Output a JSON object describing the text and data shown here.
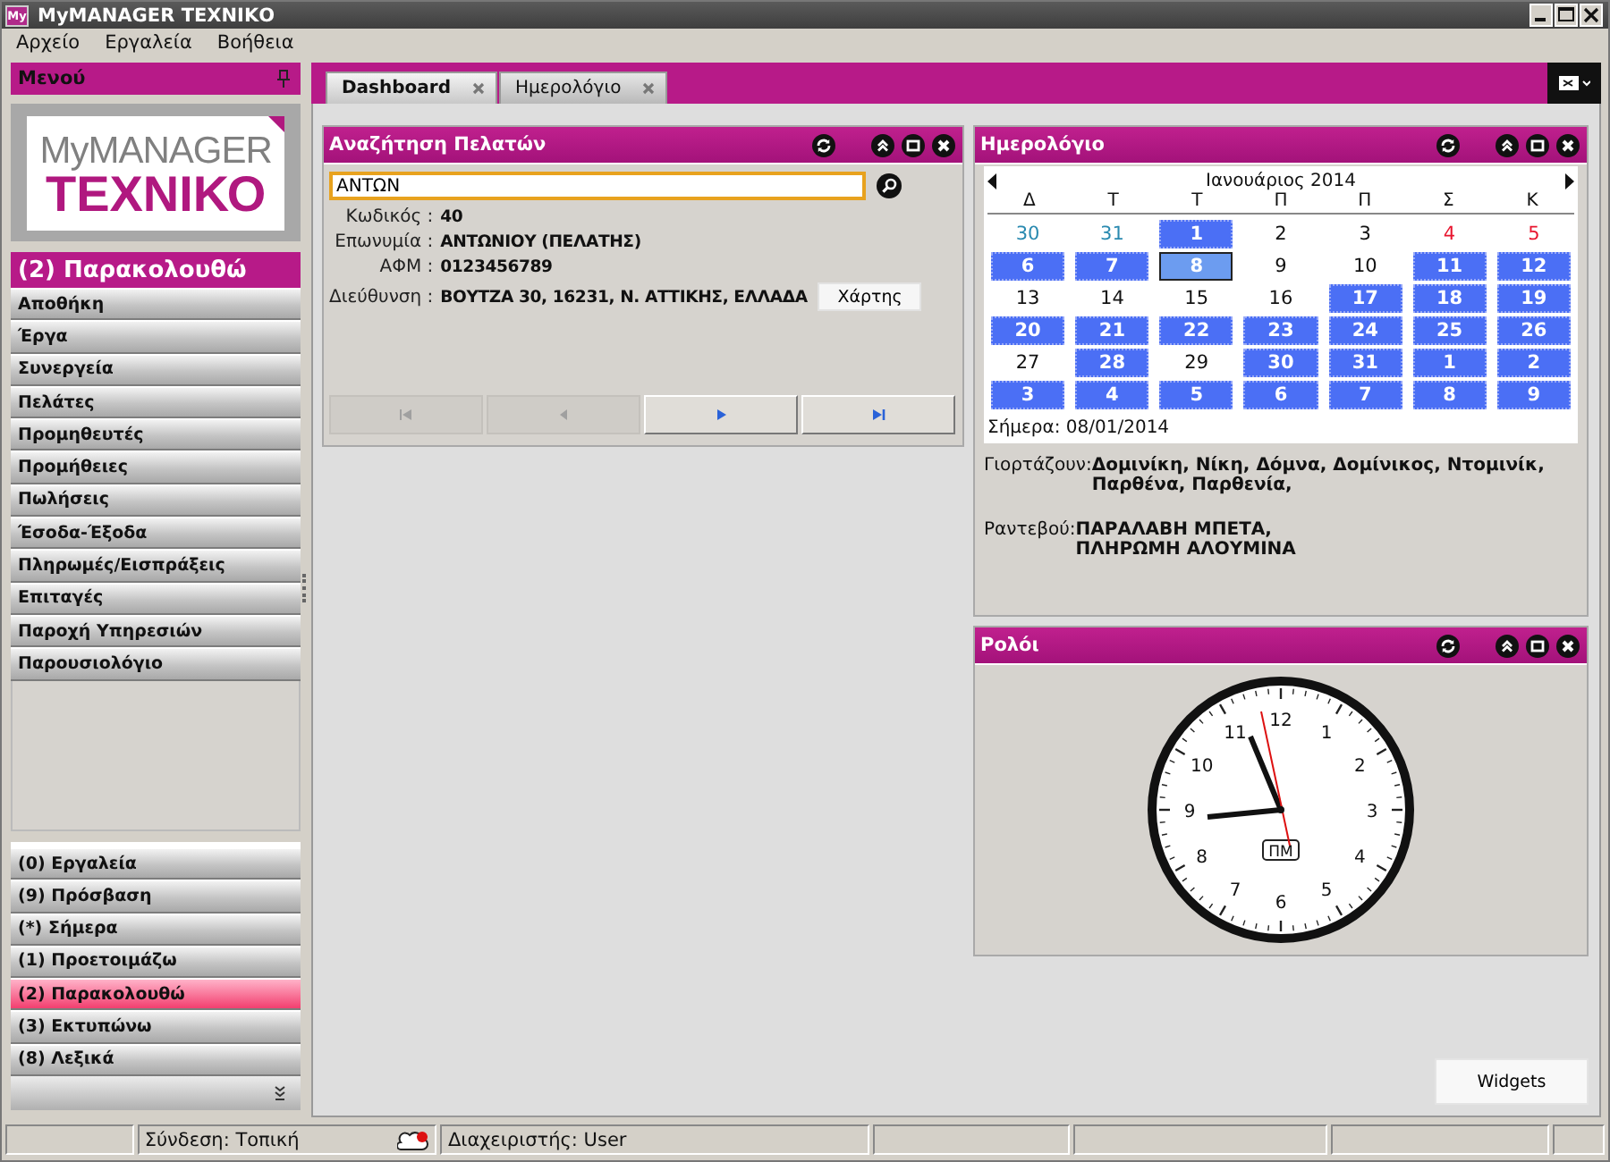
{
  "window": {
    "title": "MyMANAGER ΤΕΧΝΙΚΟ",
    "app_icon": "My"
  },
  "menu_bar": [
    "Αρχείο",
    "Εργαλεία",
    "Βοήθεια"
  ],
  "sidebar": {
    "title": "Μενού",
    "logo": {
      "line_1": "MyMANAGER",
      "line_2": "ΤΕΧΝΙΚΟ"
    },
    "section_title": "(2) Παρακολουθώ",
    "items": [
      {
        "label": "Αποθήκη",
        "selected": false
      },
      {
        "label": "Έργα",
        "selected": false
      },
      {
        "label": "Συνεργεία",
        "selected": false
      },
      {
        "label": "Πελάτες",
        "selected": false
      },
      {
        "label": "Προμηθευτές",
        "selected": false
      },
      {
        "label": "Προμήθειες",
        "selected": false
      },
      {
        "label": "Πωλήσεις",
        "selected": false
      },
      {
        "label": "Έσοδα-Έξοδα",
        "selected": false
      },
      {
        "label": "Πληρωμές/Εισπράξεις",
        "selected": false
      },
      {
        "label": "Επιταγές",
        "selected": false
      },
      {
        "label": "Παροχή Υπηρεσιών",
        "selected": false
      },
      {
        "label": "Παρουσιολόγιο",
        "selected": false
      }
    ],
    "groups": [
      {
        "label": "(0) Εργαλεία",
        "selected": false
      },
      {
        "label": "(9) Πρόσβαση",
        "selected": false
      },
      {
        "label": "(*) Σήμερα",
        "selected": false
      },
      {
        "label": "(1) Προετοιμάζω",
        "selected": false
      },
      {
        "label": "(2) Παρακολουθώ",
        "selected": true
      },
      {
        "label": "(3) Εκτυπώνω",
        "selected": false
      },
      {
        "label": "(8) Λεξικά",
        "selected": false
      }
    ]
  },
  "tabs": [
    {
      "label": "Dashboard",
      "selected": true
    },
    {
      "label": "Ημερολόγιο",
      "selected": false
    }
  ],
  "customer_search": {
    "title": "Αναζήτηση Πελατών",
    "query": "ΑΝΤΩΝ",
    "fields": [
      {
        "label": "Κωδικός :",
        "value": "40"
      },
      {
        "label": "Επωνυμία :",
        "value": "ΑΝΤΩΝΙΟΥ (ΠΕΛΑΤΗΣ)"
      },
      {
        "label": "ΑΦΜ :",
        "value": "0123456789"
      },
      {
        "label": "Διεύθυνση :",
        "value": "ΒΟΥΤΖΑ 30, 16231, Ν. ΑΤΤΙΚΗΣ, ΕΛΛΑΔΑ"
      }
    ],
    "map_button": "Χάρτης",
    "nav_buttons": [
      {
        "kind": "first",
        "disabled": true
      },
      {
        "kind": "prev",
        "disabled": true
      },
      {
        "kind": "next",
        "disabled": false
      },
      {
        "kind": "last",
        "disabled": false
      }
    ]
  },
  "calendar": {
    "title": "Ημερολόγιο",
    "month": "Ιανουάριος 2014",
    "weekdays": [
      "Δ",
      "Τ",
      "Τ",
      "Π",
      "Π",
      "Σ",
      "Κ"
    ],
    "days": [
      {
        "day": "30",
        "kind": "other",
        "marked": false,
        "selected": false
      },
      {
        "day": "31",
        "kind": "other",
        "marked": false,
        "selected": false
      },
      {
        "day": "1",
        "kind": "normal",
        "marked": true,
        "selected": false
      },
      {
        "day": "2",
        "kind": "normal",
        "marked": false,
        "selected": false
      },
      {
        "day": "3",
        "kind": "normal",
        "marked": false,
        "selected": false
      },
      {
        "day": "4",
        "kind": "weekend",
        "marked": false,
        "selected": false
      },
      {
        "day": "5",
        "kind": "weekend",
        "marked": false,
        "selected": false
      },
      {
        "day": "6",
        "kind": "normal",
        "marked": true,
        "selected": false
      },
      {
        "day": "7",
        "kind": "normal",
        "marked": true,
        "selected": false
      },
      {
        "day": "8",
        "kind": "normal",
        "marked": false,
        "selected": true
      },
      {
        "day": "9",
        "kind": "normal",
        "marked": false,
        "selected": false
      },
      {
        "day": "10",
        "kind": "normal",
        "marked": false,
        "selected": false
      },
      {
        "day": "11",
        "kind": "weekend",
        "marked": true,
        "selected": false
      },
      {
        "day": "12",
        "kind": "weekend",
        "marked": true,
        "selected": false
      },
      {
        "day": "13",
        "kind": "normal",
        "marked": false,
        "selected": false
      },
      {
        "day": "14",
        "kind": "normal",
        "marked": false,
        "selected": false
      },
      {
        "day": "15",
        "kind": "normal",
        "marked": false,
        "selected": false
      },
      {
        "day": "16",
        "kind": "normal",
        "marked": false,
        "selected": false
      },
      {
        "day": "17",
        "kind": "normal",
        "marked": true,
        "selected": false
      },
      {
        "day": "18",
        "kind": "weekend",
        "marked": true,
        "selected": false
      },
      {
        "day": "19",
        "kind": "weekend",
        "marked": true,
        "selected": false
      },
      {
        "day": "20",
        "kind": "normal",
        "marked": true,
        "selected": false
      },
      {
        "day": "21",
        "kind": "normal",
        "marked": true,
        "selected": false
      },
      {
        "day": "22",
        "kind": "normal",
        "marked": true,
        "selected": false
      },
      {
        "day": "23",
        "kind": "normal",
        "marked": true,
        "selected": false
      },
      {
        "day": "24",
        "kind": "normal",
        "marked": true,
        "selected": false
      },
      {
        "day": "25",
        "kind": "weekend",
        "marked": true,
        "selected": false
      },
      {
        "day": "26",
        "kind": "weekend",
        "marked": true,
        "selected": false
      },
      {
        "day": "27",
        "kind": "normal",
        "marked": false,
        "selected": false
      },
      {
        "day": "28",
        "kind": "normal",
        "marked": true,
        "selected": false
      },
      {
        "day": "29",
        "kind": "normal",
        "marked": false,
        "selected": false
      },
      {
        "day": "30",
        "kind": "normal",
        "marked": true,
        "selected": false
      },
      {
        "day": "31",
        "kind": "normal",
        "marked": true,
        "selected": false
      },
      {
        "day": "1",
        "kind": "other",
        "marked": true,
        "selected": false
      },
      {
        "day": "2",
        "kind": "other",
        "marked": true,
        "selected": false
      },
      {
        "day": "3",
        "kind": "other",
        "marked": true,
        "selected": false
      },
      {
        "day": "4",
        "kind": "other",
        "marked": true,
        "selected": false
      },
      {
        "day": "5",
        "kind": "other",
        "marked": true,
        "selected": false
      },
      {
        "day": "6",
        "kind": "other",
        "marked": true,
        "selected": false
      },
      {
        "day": "7",
        "kind": "other",
        "marked": true,
        "selected": false
      },
      {
        "day": "8",
        "kind": "other",
        "marked": true,
        "selected": false
      },
      {
        "day": "9",
        "kind": "other",
        "marked": true,
        "selected": false
      }
    ],
    "today": "Σήμερα: 08/01/2014",
    "name_days_label": "Γιορτάζουν:",
    "name_days": "Δομινίκη, Νίκη, Δόμνα, Δομίνικος, Ντομινίκ, Παρθένα, Παρθενία,",
    "appointments_label": "Ραντεβού:",
    "appointments": [
      "ΠΑΡΑΛΑΒΗ ΜΠΕΤΑ,",
      "ΠΛΗΡΩΜΗ ΑΛΟΥΜΙΝΑ"
    ]
  },
  "clock": {
    "title": "Ρολόι",
    "numbers": [
      "12",
      "1",
      "2",
      "3",
      "4",
      "5",
      "6",
      "7",
      "8",
      "9",
      "10",
      "11"
    ],
    "period": "ΠΜ"
  },
  "widgets_button": "Widgets",
  "status_bar": {
    "connection": "Σύνδεση: Τοπική",
    "user": "Διαχειριστής: User"
  }
}
